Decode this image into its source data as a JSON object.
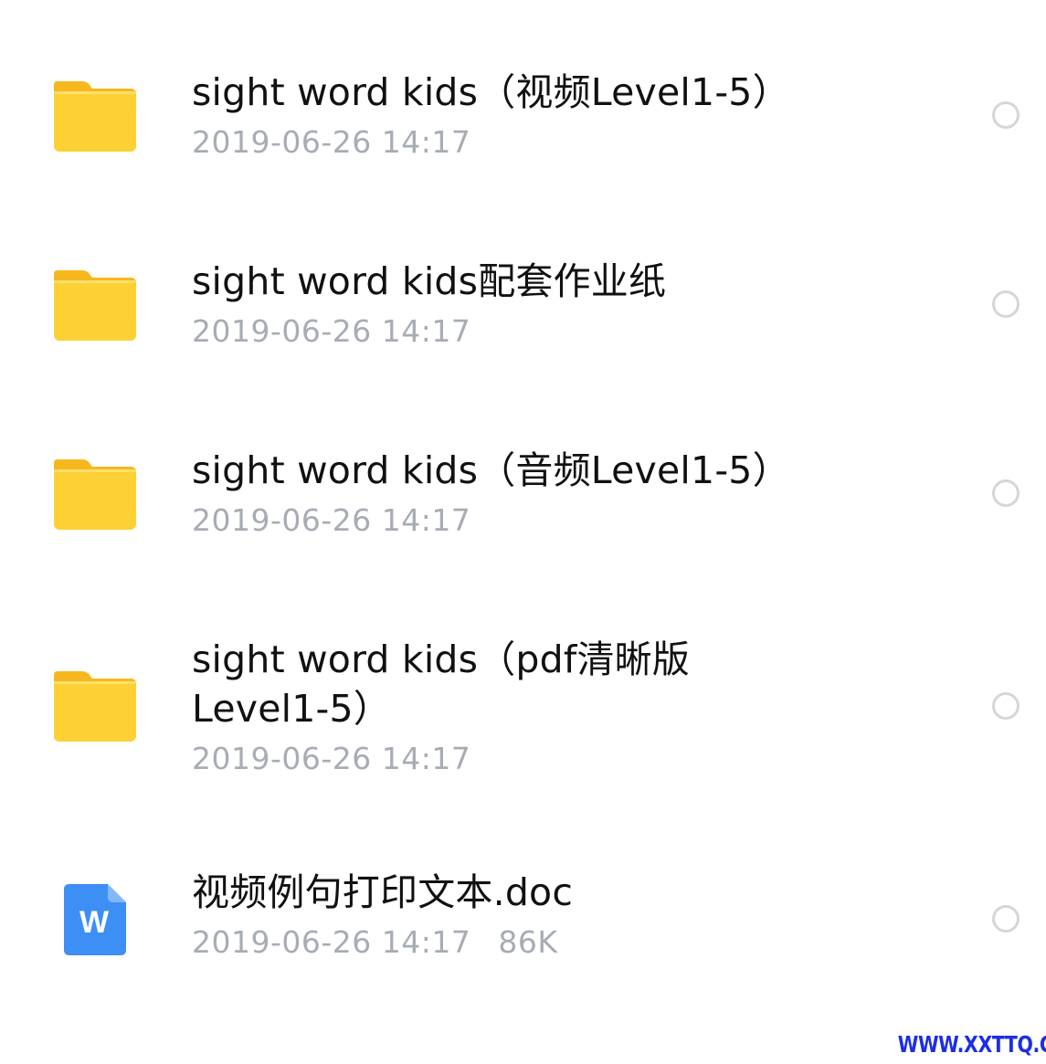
{
  "files": [
    {
      "name": "sight word kids（视频Level1-5）",
      "date": "2019-06-26 14:17",
      "type": "folder"
    },
    {
      "name": "sight word kids配套作业纸",
      "date": "2019-06-26 14:17",
      "type": "folder"
    },
    {
      "name": "sight word kids（音频Level1-5）",
      "date": "2019-06-26 14:17",
      "type": "folder"
    },
    {
      "name": "sight word kids（pdf清晰版Level1-5）",
      "date": "2019-06-26 14:17",
      "type": "folder"
    },
    {
      "name": "视频例句打印文本.doc",
      "date": "2019-06-26 14:17",
      "size": "86K",
      "type": "word-document",
      "badge_letter": "W"
    }
  ],
  "watermark": "WWW.XXTTQ.COM",
  "colors": {
    "folder_yellow": "#fdd035",
    "folder_yellow_dark": "#f6b81e",
    "word_blue": "#3d8ff5",
    "meta_gray": "#a7acb5",
    "radio_border": "#d6d6d9",
    "watermark_blue": "#1d2ee8"
  },
  "icons": {
    "folder": "folder-icon",
    "document": "word-doc-icon",
    "selector": "radio-unchecked-icon"
  }
}
